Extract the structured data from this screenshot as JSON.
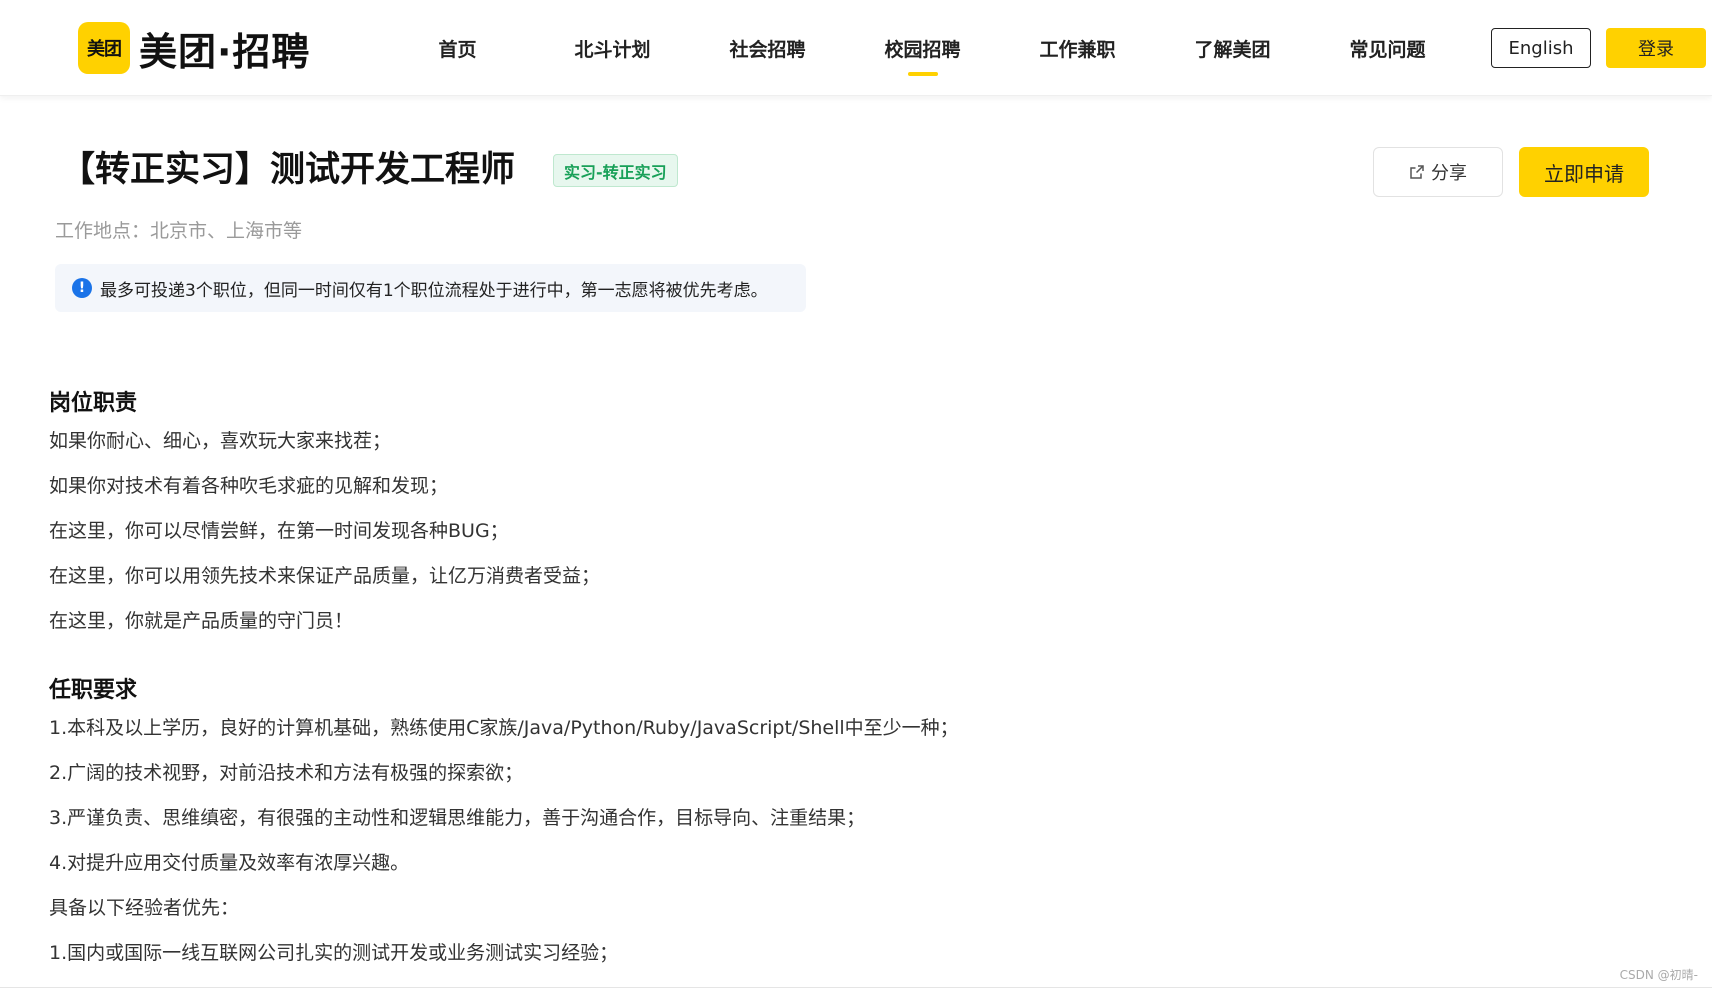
{
  "header": {
    "logo_badge": "美团",
    "logo_text": "美团·招聘",
    "nav": [
      {
        "label": "首页"
      },
      {
        "label": "北斗计划"
      },
      {
        "label": "社会招聘"
      },
      {
        "label": "校园招聘",
        "active": true
      },
      {
        "label": "工作兼职"
      },
      {
        "label": "了解美团"
      },
      {
        "label": "常见问题"
      }
    ],
    "english_label": "English",
    "login_label": "登录"
  },
  "job": {
    "title": "【转正实习】测试开发工程师",
    "tag": "实习-转正实习",
    "location": "工作地点：北京市、上海市等",
    "notice_icon": "!",
    "notice": "最多可投递3个职位，但同一时间仅有1个职位流程处于进行中，第一志愿将被优先考虑。",
    "share_label": "分享",
    "apply_label": "立即申请"
  },
  "responsibilities": {
    "heading": "岗位职责",
    "items": [
      "如果你耐心、细心，喜欢玩大家来找茬；",
      "如果你对技术有着各种吹毛求疵的见解和发现；",
      "在这里，你可以尽情尝鲜，在第一时间发现各种BUG；",
      "在这里，你可以用领先技术来保证产品质量，让亿万消费者受益；",
      "在这里，你就是产品质量的守门员！"
    ]
  },
  "requirements": {
    "heading": "任职要求",
    "items": [
      "1.本科及以上学历，良好的计算机基础，熟练使用C家族/Java/Python/Ruby/JavaScript/Shell中至少一种；",
      "2.广阔的技术视野，对前沿技术和方法有极强的探索欲；",
      "3.严谨负责、思维缜密，有很强的主动性和逻辑思维能力，善于沟通合作，目标导向、注重结果；",
      "4.对提升应用交付质量及效率有浓厚兴趣。",
      "具备以下经验者优先：",
      "1.国内或国际一线互联网公司扎实的测试开发或业务测试实习经验；"
    ]
  },
  "watermark": "CSDN @初晴-",
  "colors": {
    "brand_yellow": "#ffd100",
    "tag_green": "#18a058",
    "notice_blue": "#1a73e8"
  }
}
